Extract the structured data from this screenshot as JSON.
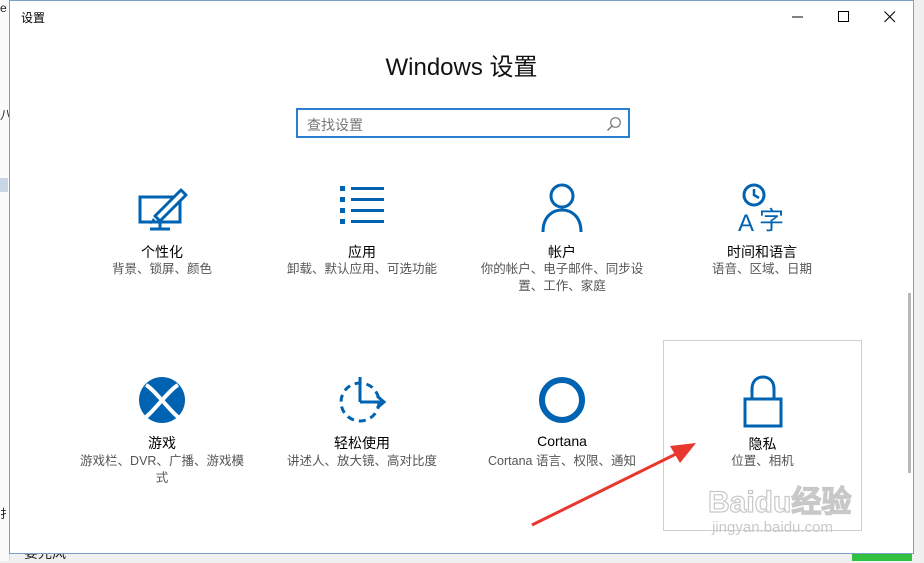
{
  "window": {
    "title": "设置"
  },
  "heading": "Windows 设置",
  "search": {
    "placeholder": "查找设置"
  },
  "tiles": [
    {
      "title": "个性化",
      "desc": "背景、锁屏、颜色"
    },
    {
      "title": "应用",
      "desc": "卸载、默认应用、可选功能"
    },
    {
      "title": "帐户",
      "desc": "你的帐户、电子邮件、同步设置、工作、家庭"
    },
    {
      "title": "时间和语言",
      "desc": "语音、区域、日期"
    },
    {
      "title": "游戏",
      "desc": "游戏栏、DVR、广播、游戏模式"
    },
    {
      "title": "轻松使用",
      "desc": "讲述人、放大镜、高对比度"
    },
    {
      "title": "Cortana",
      "desc": "Cortana 语言、权限、通知"
    },
    {
      "title": "隐私",
      "desc": "位置、相机"
    }
  ],
  "background": {
    "frag1": "e",
    "frag2": "八",
    "frag3": "扌",
    "bottom": "娄光风"
  },
  "watermark": {
    "brand": "Baidu经验",
    "url": "jingyan.baidu.com"
  },
  "colors": {
    "accent": "#0063b1",
    "arrow": "#e8372e",
    "search_border": "#2a7fd0"
  }
}
